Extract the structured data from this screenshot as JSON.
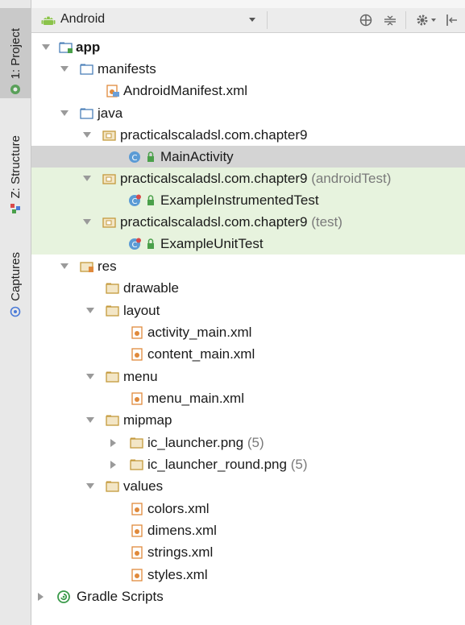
{
  "toolwindows": [
    {
      "label": "1: Project",
      "active": true
    },
    {
      "label": "Z: Structure",
      "active": false
    },
    {
      "label": "Captures",
      "active": false
    }
  ],
  "header": {
    "view_mode": "Android"
  },
  "tree": [
    {
      "label": "app",
      "bold": true
    },
    {
      "label": "manifests"
    },
    {
      "label": "AndroidManifest.xml"
    },
    {
      "label": "java"
    },
    {
      "label": "practicalscaladsl.com.chapter9"
    },
    {
      "label": "MainActivity"
    },
    {
      "label": "practicalscaladsl.com.chapter9",
      "suffix": "(androidTest)"
    },
    {
      "label": "ExampleInstrumentedTest"
    },
    {
      "label": "practicalscaladsl.com.chapter9",
      "suffix": "(test)"
    },
    {
      "label": "ExampleUnitTest"
    },
    {
      "label": "res"
    },
    {
      "label": "drawable"
    },
    {
      "label": "layout"
    },
    {
      "label": "activity_main.xml"
    },
    {
      "label": "content_main.xml"
    },
    {
      "label": "menu"
    },
    {
      "label": "menu_main.xml"
    },
    {
      "label": "mipmap"
    },
    {
      "label": "ic_launcher.png",
      "suffix": "(5)"
    },
    {
      "label": "ic_launcher_round.png",
      "suffix": "(5)"
    },
    {
      "label": "values"
    },
    {
      "label": "colors.xml"
    },
    {
      "label": "dimens.xml"
    },
    {
      "label": "strings.xml"
    },
    {
      "label": "styles.xml"
    },
    {
      "label": "Gradle Scripts"
    }
  ]
}
